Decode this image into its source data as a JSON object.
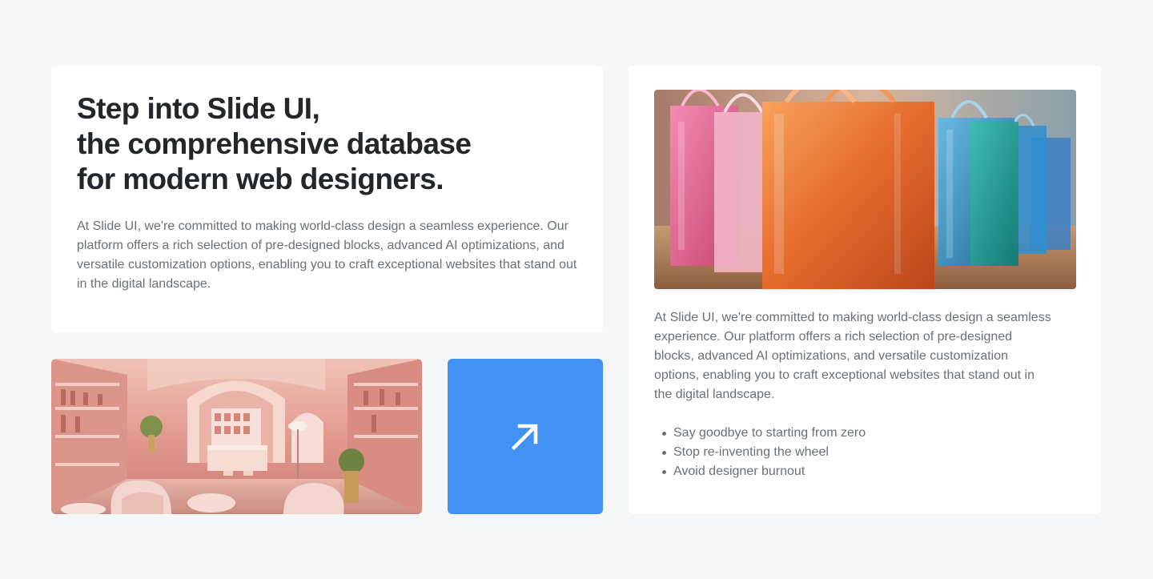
{
  "hero": {
    "title_lines": [
      "Step into Slide UI,",
      "the comprehensive database",
      "for modern web designers."
    ],
    "description": "At Slide UI, we're committed to making world-class design a seamless experience. Our platform offers a rich selection of pre-designed blocks, advanced AI optimizations, and versatile customization options, enabling you to craft exceptional websites that stand out in the digital landscape."
  },
  "cta": {
    "icon": "arrow-up-right-icon",
    "color": "#4192f2"
  },
  "side": {
    "description": "At Slide UI, we're committed to making world-class design a seamless experience. Our platform offers a rich selection of pre-designed blocks, advanced AI optimizations, and versatile customization options, enabling you to craft exceptional websites that stand out in the digital landscape.",
    "bullets": [
      "Say goodbye to starting from zero",
      "Stop re-inventing the wheel",
      "Avoid designer burnout"
    ]
  }
}
